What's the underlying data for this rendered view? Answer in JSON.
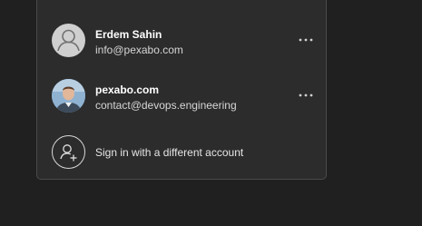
{
  "accounts": [
    {
      "name": "Erdem Sahin",
      "email": "info@pexabo.com",
      "avatar": "generic-user-icon"
    },
    {
      "name": "pexabo.com",
      "email": "contact@devops.engineering",
      "avatar": "profile-photo"
    }
  ],
  "add_account": {
    "label": "Sign in with a different account",
    "icon": "add-user-icon"
  },
  "more_icon": "more-options-icon",
  "colors": {
    "background": "#202020",
    "panel": "#2c2c2c",
    "border": "#4a4a4a",
    "text_primary": "#ffffff",
    "text_secondary": "#d6d6d6"
  }
}
